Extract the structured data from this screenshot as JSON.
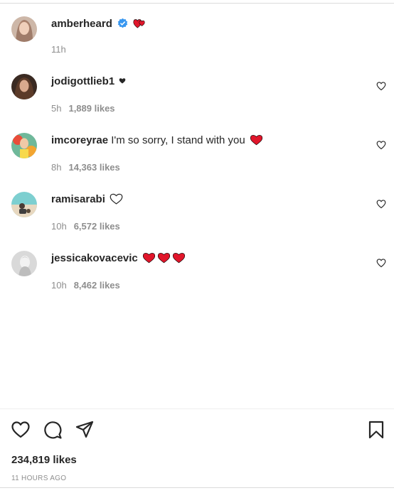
{
  "caption": {
    "username": "amberheard",
    "time": "11h",
    "verified_icon": "verified-badge-icon",
    "emoji_icon": "two-hearts-icon"
  },
  "comments": [
    {
      "username": "jodigottlieb1",
      "text": "",
      "emoji": "black-heart",
      "time": "5h",
      "likes": "1,889 likes"
    },
    {
      "username": "imcoreyrae",
      "text": "I'm so sorry, I stand with you",
      "emoji": "red-heart",
      "time": "8h",
      "likes": "14,363 likes"
    },
    {
      "username": "ramisarabi",
      "text": "",
      "emoji": "white-heart",
      "time": "10h",
      "likes": "6,572 likes"
    },
    {
      "username": "jessicakovacevic",
      "text": "",
      "emoji": "three-red-hearts",
      "time": "10h",
      "likes": "8,462 likes"
    }
  ],
  "actions": [
    "like-icon",
    "comment-icon",
    "share-icon",
    "save-icon"
  ],
  "post": {
    "likes": "234,819 likes",
    "timestamp": "11 HOURS AGO"
  },
  "colors": {
    "heart_red": "#e0162b",
    "verified_blue": "#3897f0",
    "muted": "#8e8e8e"
  }
}
